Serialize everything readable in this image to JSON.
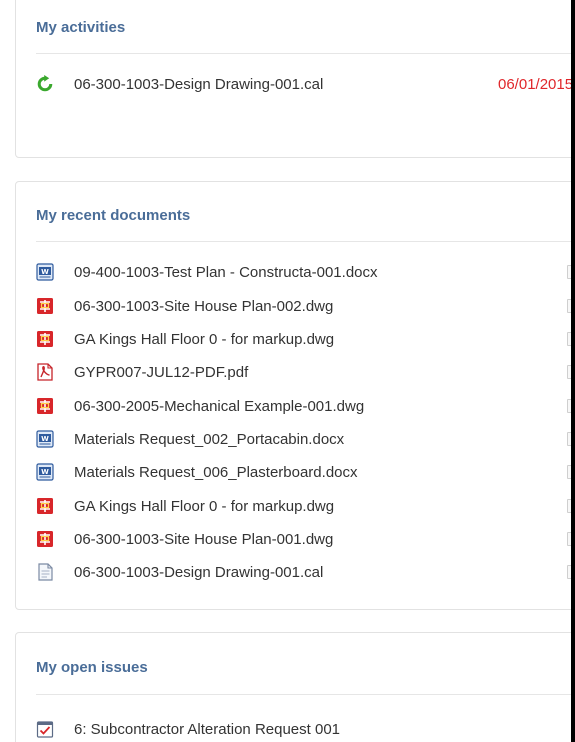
{
  "activities": {
    "title": "My activities",
    "items": [
      {
        "name": "06-300-1003-Design Drawing-001.cal",
        "date": "06/01/2015",
        "icon": "refresh-icon"
      }
    ]
  },
  "recent_documents": {
    "title": "My recent documents",
    "items": [
      {
        "name": "09-400-1003-Test Plan - Constructa-001.docx",
        "icon": "word-doc-icon"
      },
      {
        "name": "06-300-1003-Site House Plan-002.dwg",
        "icon": "dwg-file-icon"
      },
      {
        "name": "GA Kings Hall Floor 0 - for markup.dwg",
        "icon": "dwg-file-icon"
      },
      {
        "name": "GYPR007-JUL12-PDF.pdf",
        "icon": "pdf-file-icon"
      },
      {
        "name": "06-300-2005-Mechanical Example-001.dwg",
        "icon": "dwg-file-icon"
      },
      {
        "name": "Materials Request_002_Portacabin.docx",
        "icon": "word-doc-icon"
      },
      {
        "name": "Materials Request_006_Plasterboard.docx",
        "icon": "word-doc-icon"
      },
      {
        "name": "GA Kings Hall Floor 0 - for markup.dwg",
        "icon": "dwg-file-icon"
      },
      {
        "name": "06-300-1003-Site House Plan-001.dwg",
        "icon": "dwg-file-icon"
      },
      {
        "name": "06-300-1003-Design Drawing-001.cal",
        "icon": "generic-file-icon"
      }
    ]
  },
  "open_issues": {
    "title": "My open issues",
    "items": [
      {
        "name": "6: Subcontractor Alteration Request 001",
        "icon": "issue-checklist-icon"
      }
    ]
  },
  "colors": {
    "heading": "#4a6d98",
    "date": "#e0272b",
    "refresh": "#3aa82e",
    "dwg": "#d8262a",
    "word": "#2f5b9e"
  }
}
